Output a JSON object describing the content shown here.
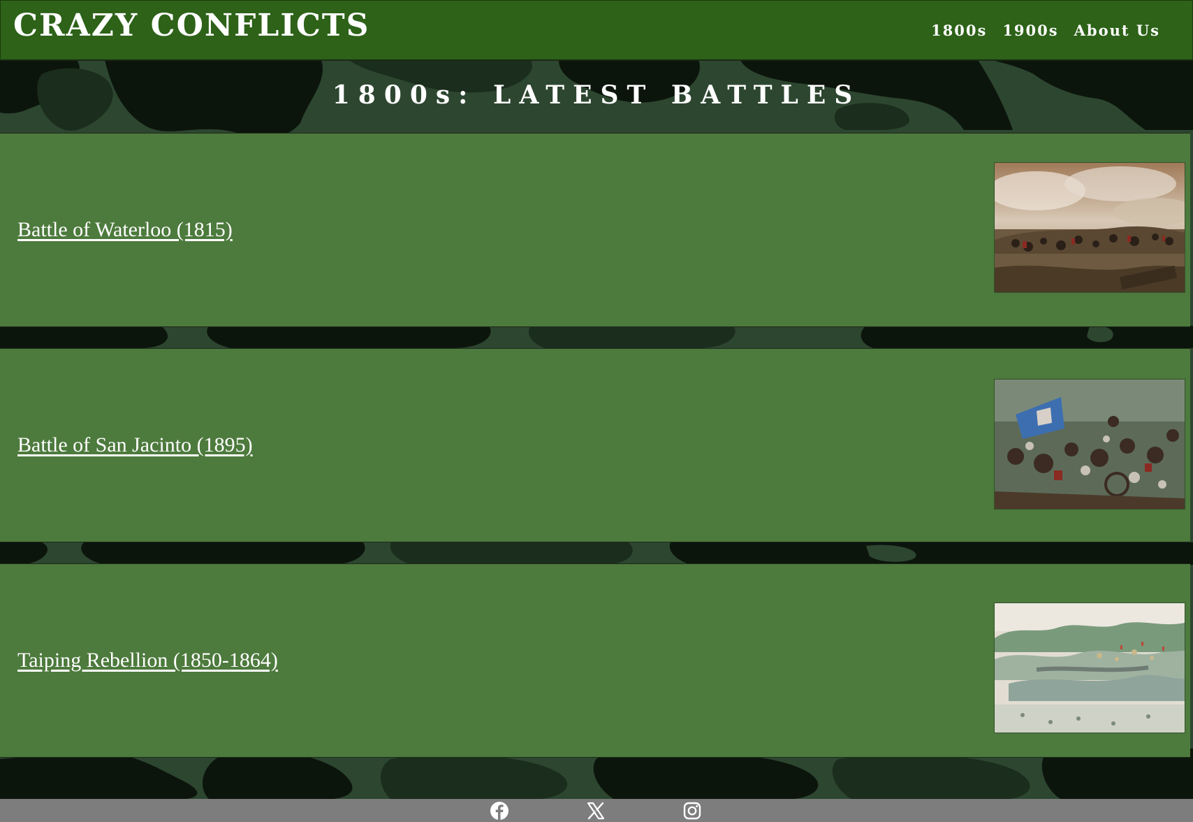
{
  "header": {
    "site_title": "CRAZY CONFLICTS",
    "nav": [
      {
        "label": "1800s"
      },
      {
        "label": "1900s"
      },
      {
        "label": "About Us"
      }
    ]
  },
  "page": {
    "heading": "1800s: LATEST BATTLES"
  },
  "battles": [
    {
      "title": "Battle of Waterloo (1815)",
      "image": "waterloo-painting"
    },
    {
      "title": "Battle of San Jacinto (1895)",
      "image": "san-jacinto-painting"
    },
    {
      "title": "Taiping Rebellion (1850-1864)",
      "image": "taiping-rebellion-painting"
    }
  ],
  "footer": {
    "social": [
      {
        "icon": "facebook-icon"
      },
      {
        "icon": "x-icon"
      },
      {
        "icon": "instagram-icon"
      }
    ]
  },
  "colors": {
    "header_bg": "#2d6218",
    "card_bg": "#4d7a3d",
    "camo_dark": "#0c150c",
    "camo_mid": "#2d4630",
    "footer_bg": "#7d7d7d"
  }
}
